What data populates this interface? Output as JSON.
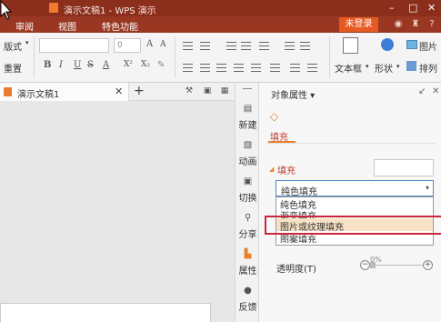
{
  "window": {
    "title": "演示文稿1 - WPS 演示",
    "min": "–",
    "restore": "□",
    "close": "✕"
  },
  "menu": {
    "items": [
      "审阅",
      "视图",
      "特色功能"
    ],
    "login": "未登录"
  },
  "ribbon": {
    "layout": "版式",
    "reset": "重置",
    "font_size": "0",
    "grow_font": "A",
    "shrink_font": "A",
    "styles": [
      "B",
      "I",
      "U",
      "S",
      "A",
      "X²",
      "X₂"
    ],
    "textbox": "文本框",
    "shape": "形状",
    "picture": "图片",
    "arrange": "排列"
  },
  "doc": {
    "tab_label": "演示文稿1",
    "close": "✕",
    "add": "+"
  },
  "side": {
    "items": [
      {
        "label": "新建",
        "icon": "new-doc-icon"
      },
      {
        "label": "动画",
        "icon": "animation-icon"
      },
      {
        "label": "切换",
        "icon": "transition-icon"
      },
      {
        "label": "分享",
        "icon": "share-icon"
      },
      {
        "label": "属性",
        "icon": "property-icon"
      },
      {
        "label": "反馈",
        "icon": "feedback-icon"
      }
    ],
    "active": "属性"
  },
  "panel": {
    "title": "对象属性 ▾",
    "tab": "填充",
    "section": "填充",
    "selected": "纯色填充",
    "options": [
      "纯色填充",
      "渐变填充",
      "图片或纹理填充",
      "图案填充"
    ],
    "highlighted": "图片或纹理填充",
    "transparency_label": "透明度(T)",
    "transparency_value": "0%",
    "transparency": 0
  },
  "colors": {
    "titlebar": "#8c2e1c",
    "menubar": "#9a3722",
    "login": "#e65a24",
    "accent": "#e8812c",
    "highlight_border": "#c8283a"
  }
}
